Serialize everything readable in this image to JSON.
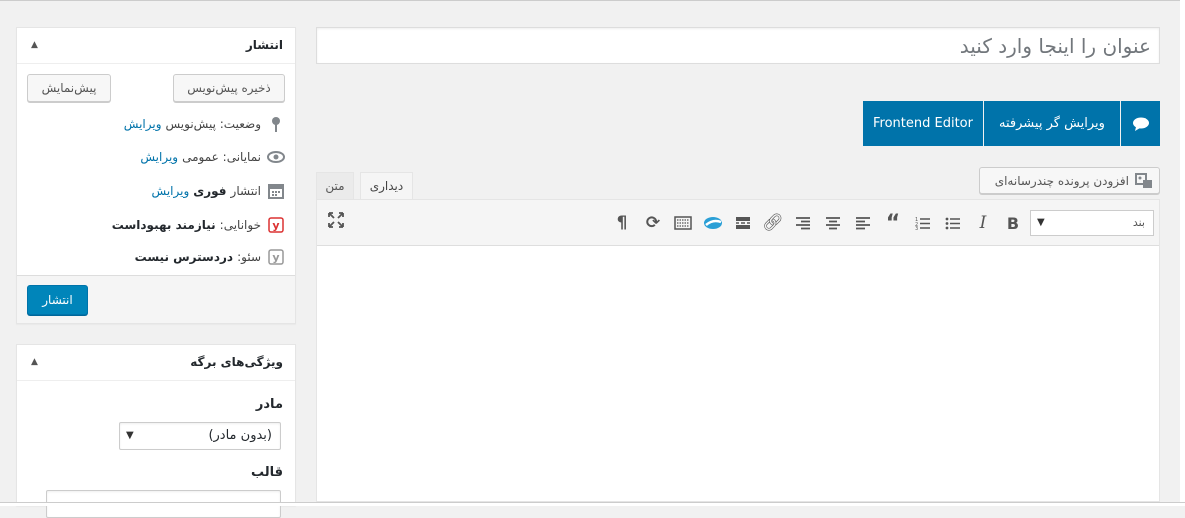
{
  "title_placeholder": "عنوان را اینجا وارد کنید",
  "page_builder": {
    "frontend_editor": "Frontend Editor",
    "backend_editor": "ویرایش گر پیشرفته"
  },
  "media": {
    "add_media": "افزودن پرونده چندرسانه‌ای"
  },
  "tabs": {
    "visual": "دیداری",
    "text": "متن"
  },
  "toolbar": {
    "format_select": "بند",
    "icons": [
      "bold-icon",
      "italic-icon",
      "bullet-list-icon",
      "numbered-list-icon",
      "blockquote-icon",
      "align-left-icon",
      "align-center-icon",
      "align-right-icon",
      "link-icon",
      "read-more-icon",
      "brand-icon",
      "toolbar-toggle-icon",
      "refresh-icon",
      "paragraph-rtl-icon",
      "fullscreen-icon"
    ]
  },
  "publish": {
    "title": "انتشار",
    "save_draft": "ذخیره پیش‌نویس",
    "preview": "پیش‌نمایش",
    "status_label": "وضعیت:",
    "status_value": "پیش‌نویس",
    "visibility_label": "نمایانی:",
    "visibility_value": "عمومی",
    "schedule_label": "انتشار",
    "schedule_value": "فوری",
    "readability_label": "خوانایی:",
    "readability_value": "نیازمند بهبوداست",
    "seo_label": "سئو:",
    "seo_value": "دردسترس نیست",
    "edit_link": "ویرایش",
    "publish_button": "انتشار"
  },
  "page_attributes": {
    "title": "ویژگی‌های برگه",
    "parent_label": "مادر",
    "parent_value": "(بدون مادر)",
    "template_label": "قالب"
  },
  "colors": {
    "primary": "#0085ba",
    "vc_blue": "#0073aa",
    "link": "#0073aa",
    "yoast_red": "#dc3232"
  }
}
